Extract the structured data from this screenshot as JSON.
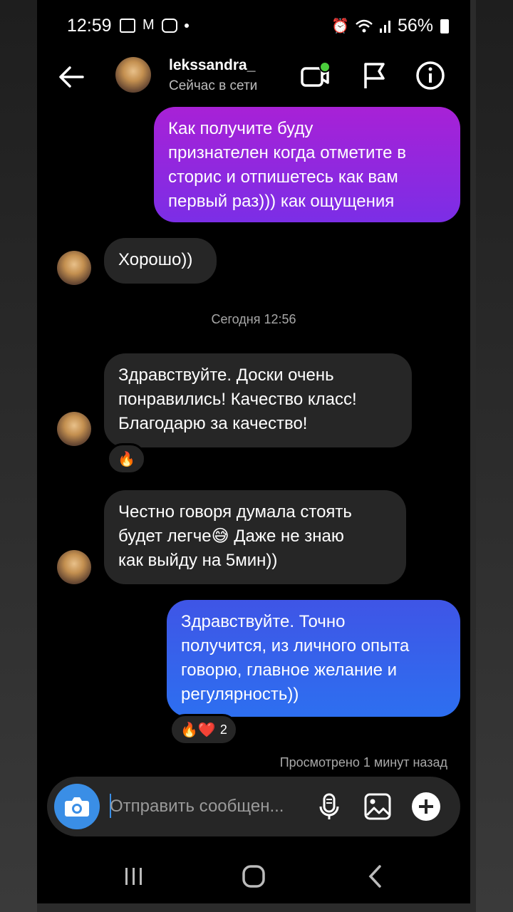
{
  "status_bar": {
    "time": "12:59",
    "battery": "56%"
  },
  "header": {
    "name": "lekssandra_",
    "status": "Сейчас в сети",
    "icons": [
      "back-arrow-icon",
      "video-call-icon",
      "flag-icon",
      "info-icon"
    ]
  },
  "messages": [
    {
      "type": "outgoing",
      "text": "Как получите буду\nпризнателен когда отметите в\nсторис и отпишетесь как вам\nпервый раз))) как ощущения"
    },
    {
      "type": "incoming",
      "text": "Хорошо))"
    },
    {
      "type": "incoming",
      "text": "Здравствуйте. Доски очень\nпонравились! Качество класс!\nБлагодарю за качество!",
      "reaction": "🔥"
    },
    {
      "type": "incoming",
      "text": "Честно говоря думала стоять\nбудет легче😅 Даже  не знаю\nкак выйду на 5мин))"
    },
    {
      "type": "outgoing",
      "text": "Здравствуйте. Точно\nполучится, из личного опыта\nговорю, главное желание и\nрегулярность))",
      "reaction": "🔥❤️",
      "reaction_count": "2"
    }
  ],
  "timestamp": "Сегодня 12:56",
  "seen": "Просмотрено 1 минут назад",
  "composer": {
    "placeholder": "Отправить сообщен..."
  },
  "colors": {
    "accent_blue": "#3a8ee6",
    "bubble_in": "#262626",
    "bubble_out_purple": "#a821d6",
    "bubble_out_blue": "#3f55e6"
  }
}
